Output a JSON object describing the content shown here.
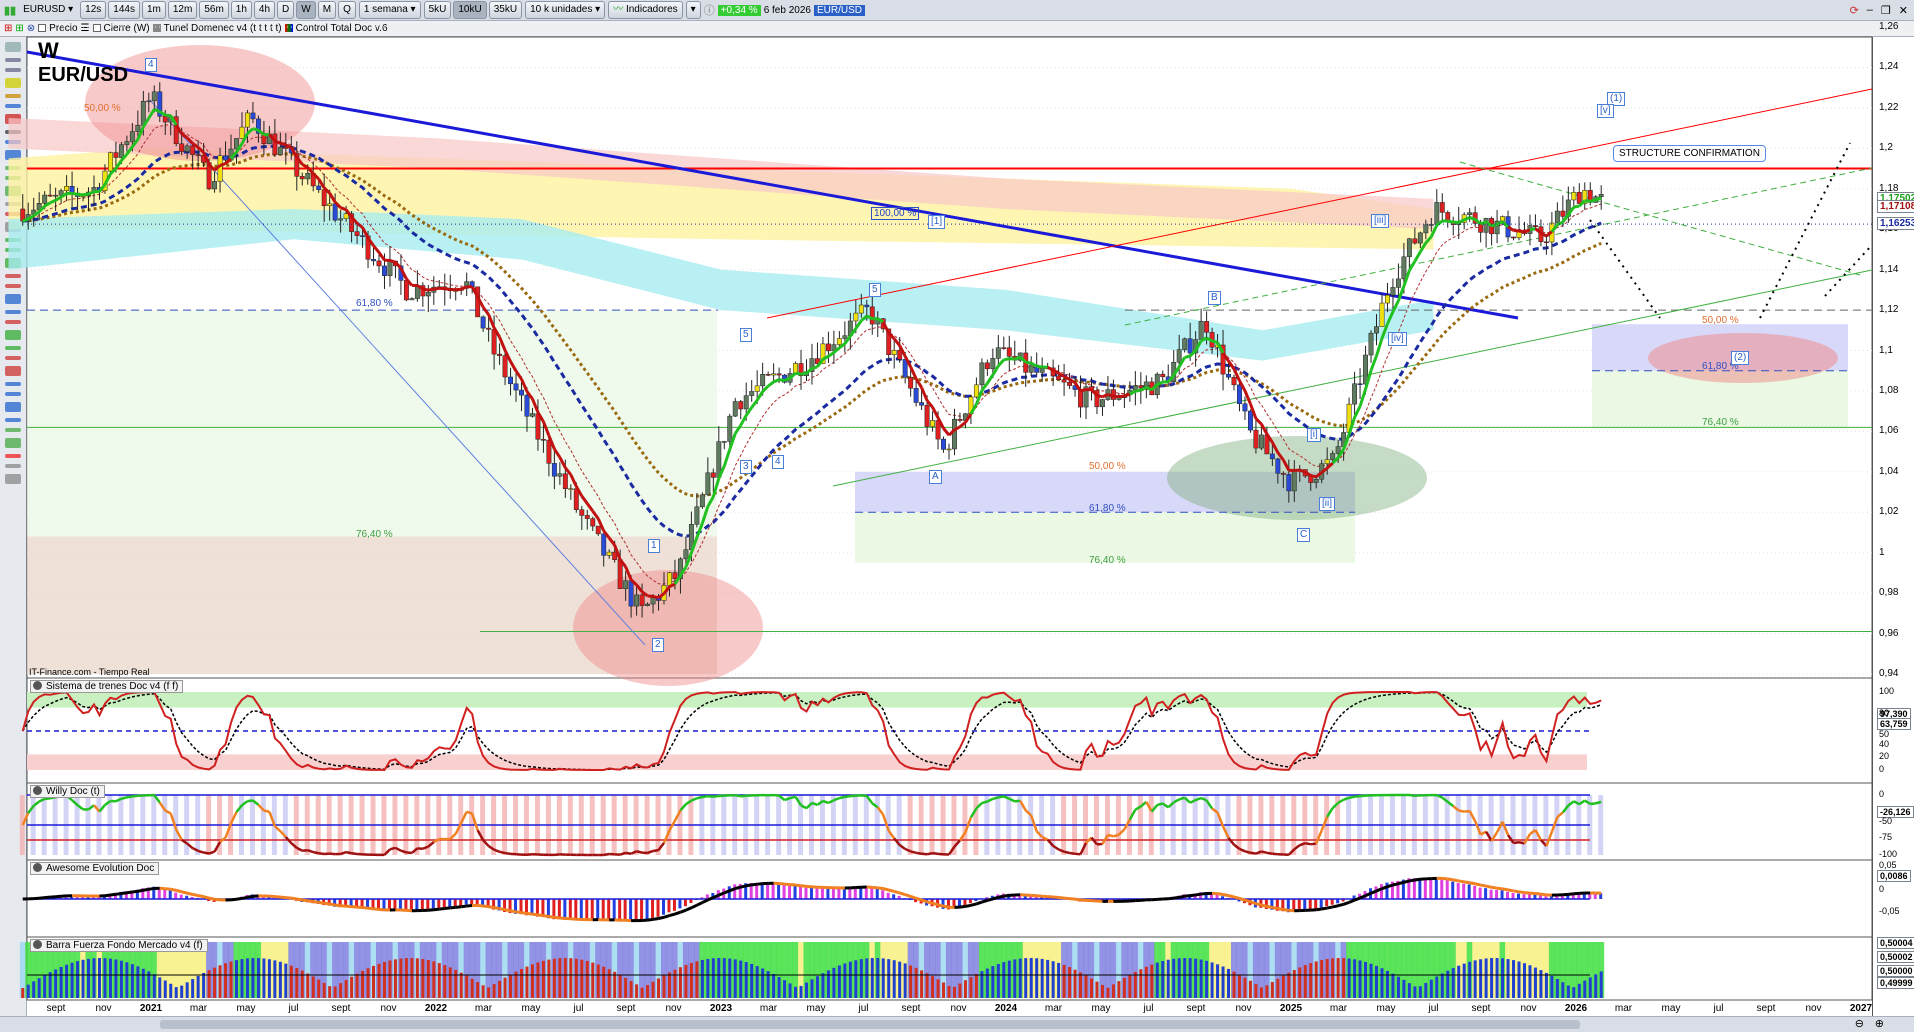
{
  "toolbar": {
    "symbol": "EURUSD",
    "timeframes": [
      "12s",
      "144s",
      "1m",
      "12m",
      "56m",
      "1h",
      "4h",
      "D",
      "W",
      "M",
      "Q"
    ],
    "active_timeframe": "W",
    "period": "1 semana",
    "units": [
      "5kU",
      "10kU",
      "35kU"
    ],
    "active_unit": "10kU",
    "unit_select": "10 k unidades",
    "indicators": "Indicadores",
    "change": "+0,34 %",
    "date": "6 feb 2026",
    "pair": "EUR/USD"
  },
  "legend": {
    "price": "Precio",
    "close": "Cierre (W)",
    "tunnel": "Tunel Domenec v4 (t t t t t)",
    "control": "Control Total Doc v.6"
  },
  "chart_title": {
    "letter": "W",
    "pair": "EUR/USD",
    "source": "IT-Finance.com - Tiempo Real"
  },
  "annotations": {
    "structure": "STRUCTURE CONFIRMATION",
    "fib50a": "50,00 %",
    "fib618a": "61,80 %",
    "fib764a": "76,40 %",
    "fib100": "100,00 %",
    "fib50b": "50,00 %",
    "fib618b": "61,80 %",
    "fib764b": "76,40 %",
    "fib50c": "50,00 %",
    "fib618c": "61,80 %",
    "fib764c": "76,40 %"
  },
  "waves": [
    "4",
    "5",
    "3",
    "4",
    "1",
    "2",
    "5",
    "A",
    "B",
    "C",
    "[i]",
    "[ii]",
    "[iii]",
    "[iv]",
    "(1)",
    "[v]",
    "(2)",
    "[1]"
  ],
  "price_tags": [
    {
      "value": "1,17502",
      "color": "#1aa01a"
    },
    {
      "value": "1,17108",
      "color": "#a01010"
    },
    {
      "value": "1,16253",
      "color": "#1a2aa0"
    }
  ],
  "panels": [
    {
      "title": "Sistema de trenes Doc v4 (f f)",
      "ticks": [
        "100",
        "97,390",
        "80",
        "63,759",
        "50",
        "40",
        "20",
        "0"
      ]
    },
    {
      "title": "Willy Doc (t)",
      "ticks": [
        "0",
        "-26,126",
        "-50",
        "-75",
        "-100"
      ]
    },
    {
      "title": "Awesome Evolution Doc",
      "ticks": [
        "0,05",
        "0,0086",
        "0",
        "-0,05"
      ]
    },
    {
      "title": "Barra Fuerza Fondo Mercado v4 (f)",
      "ticks": [
        "0,50004",
        "0,50002",
        "0,50000",
        "0,49999"
      ]
    }
  ],
  "chart_data": {
    "type": "candlestick",
    "title": "EUR/USD",
    "timeframe": "weekly",
    "ylim": [
      0.94,
      1.26
    ],
    "yticks": [
      "1,26",
      "1,24",
      "1,22",
      "1,2",
      "1,18",
      "1,16",
      "1,14",
      "1,12",
      "1,1",
      "1,08",
      "1,06",
      "1,04",
      "1,02",
      "1",
      "0,98",
      "0,96",
      "0,94"
    ],
    "xticks": [
      "sept",
      "nov",
      "2021",
      "mar",
      "may",
      "jul",
      "sept",
      "nov",
      "2022",
      "mar",
      "may",
      "jul",
      "sept",
      "nov",
      "2023",
      "mar",
      "may",
      "jul",
      "sept",
      "nov",
      "2024",
      "mar",
      "may",
      "jul",
      "sept",
      "nov",
      "2025",
      "mar",
      "may",
      "jul",
      "sept",
      "nov",
      "2026",
      "mar",
      "may",
      "jul",
      "sept",
      "nov",
      "2027"
    ],
    "key_points": [
      [
        2020.55,
        1.17
      ],
      [
        2020.8,
        1.18
      ],
      [
        2021.0,
        1.225
      ],
      [
        2021.2,
        1.185
      ],
      [
        2021.35,
        1.215
      ],
      [
        2021.6,
        1.175
      ],
      [
        2021.9,
        1.13
      ],
      [
        2022.1,
        1.135
      ],
      [
        2022.2,
        1.1
      ],
      [
        2022.35,
        1.06
      ],
      [
        2022.5,
        1.02
      ],
      [
        2022.72,
        0.97
      ],
      [
        2022.85,
        0.99
      ],
      [
        2023.05,
        1.075
      ],
      [
        2023.3,
        1.095
      ],
      [
        2023.52,
        1.12
      ],
      [
        2023.78,
        1.05
      ],
      [
        2023.95,
        1.1
      ],
      [
        2024.3,
        1.075
      ],
      [
        2024.55,
        1.085
      ],
      [
        2024.7,
        1.115
      ],
      [
        2024.85,
        1.06
      ],
      [
        2025.0,
        1.035
      ],
      [
        2025.15,
        1.045
      ],
      [
        2025.35,
        1.135
      ],
      [
        2025.5,
        1.17
      ],
      [
        2025.65,
        1.165
      ],
      [
        2025.88,
        1.155
      ],
      [
        2026.02,
        1.18
      ],
      [
        2026.1,
        1.173
      ]
    ],
    "levels": {
      "resistance": 1.19,
      "support1": 1.062,
      "support2": 0.961
    }
  },
  "colors": {
    "up": "#5f7f60",
    "down": "#e02020",
    "accent_blue": "#1a1ad8",
    "red_line": "#ff0000"
  }
}
